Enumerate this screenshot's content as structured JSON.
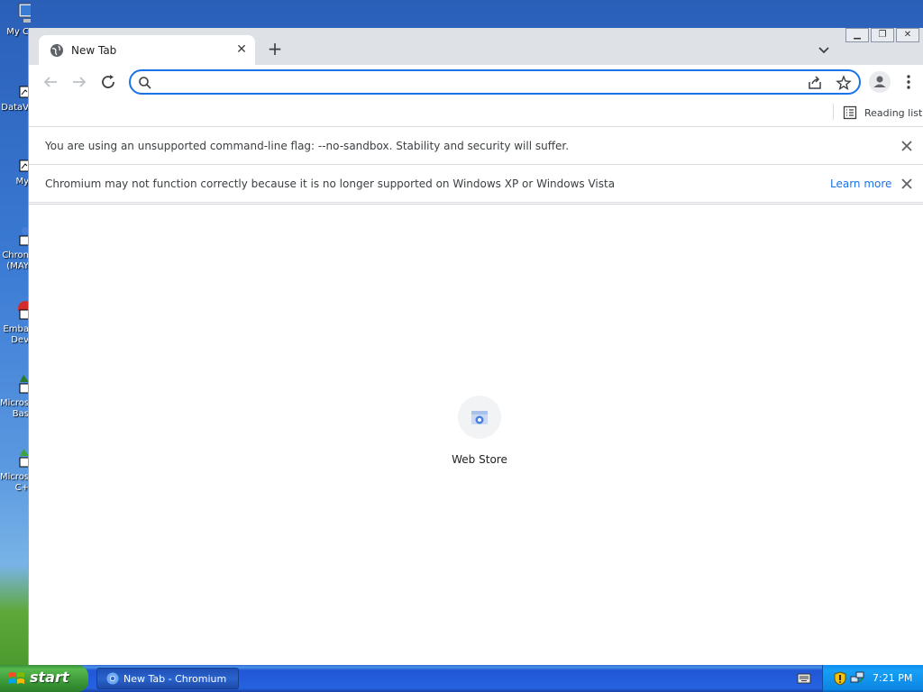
{
  "desktop": {
    "icons": [
      {
        "label": "My C"
      },
      {
        "label": "DataV"
      },
      {
        "label": "My"
      },
      {
        "label": "Chron\n(MAY"
      },
      {
        "label": "Emba\nDev"
      },
      {
        "label": "Micros\nBas"
      },
      {
        "label": "Micros\nC+"
      }
    ]
  },
  "browser": {
    "tab": {
      "title": "New Tab",
      "close_label": "✕"
    },
    "new_tab_label": "+",
    "window_controls": {
      "minimize": "▁",
      "restore": "❐",
      "close": "✕"
    },
    "omnibox": {
      "value": "",
      "placeholder": ""
    },
    "bookmarks": {
      "reading_list": "Reading list"
    },
    "infobars": [
      {
        "message": "You are using an unsupported command-line flag: --no-sandbox. Stability and security will suffer."
      },
      {
        "message": "Chromium may not function correctly because it is no longer supported on Windows XP or Windows Vista",
        "link": "Learn more"
      }
    ],
    "shortcuts": [
      {
        "name": "Web Store"
      }
    ]
  },
  "taskbar": {
    "start_label": "start",
    "tasks": [
      {
        "label": "New Tab - Chromium"
      }
    ],
    "clock": "7:21 PM"
  },
  "colors": {
    "accent": "#1a73e8",
    "xp_taskbar": "#245edb",
    "xp_start": "#3c9a38"
  }
}
